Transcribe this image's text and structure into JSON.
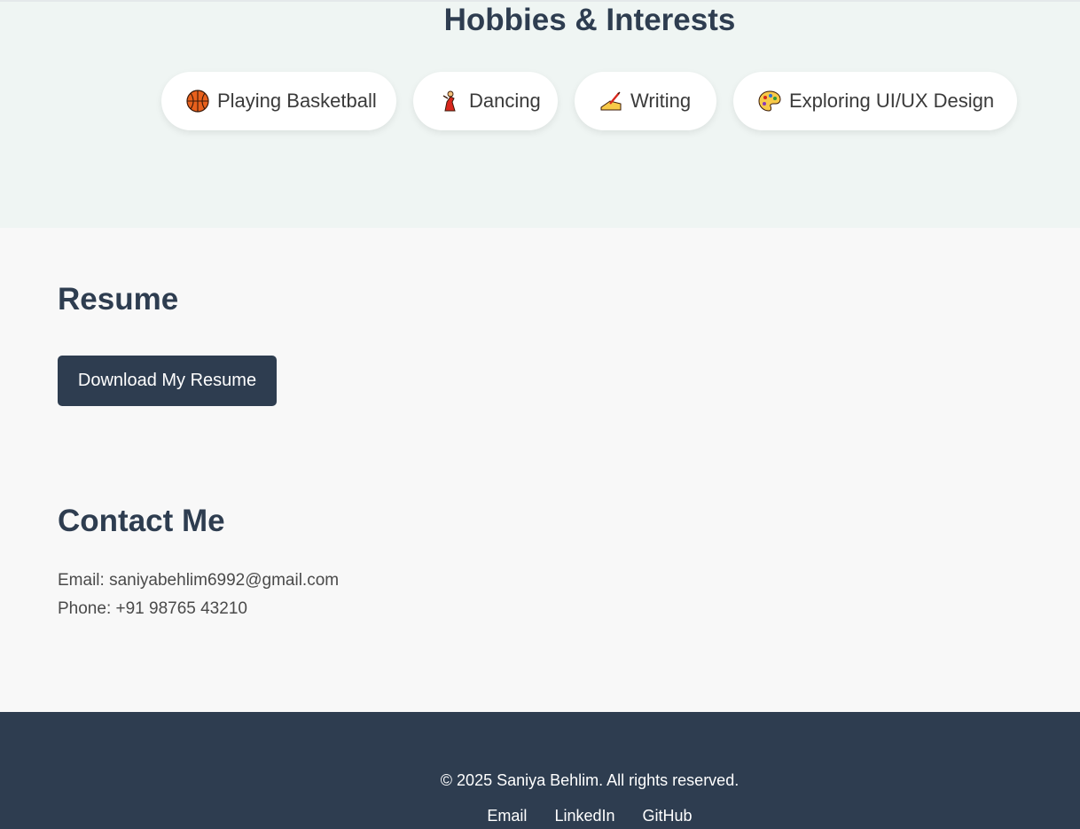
{
  "hobbies": {
    "title": "Hobbies & Interests",
    "items": [
      {
        "label": "Playing Basketball",
        "icon": "basketball-icon"
      },
      {
        "label": "Dancing",
        "icon": "dancer-icon"
      },
      {
        "label": "Writing",
        "icon": "writing-hand-icon"
      },
      {
        "label": "Exploring UI/UX Design",
        "icon": "palette-icon"
      }
    ]
  },
  "resume": {
    "title": "Resume",
    "button_label": "Download My Resume"
  },
  "contact": {
    "title": "Contact Me",
    "email_line": "Email: saniyabehlim6992@gmail.com",
    "phone_line": "Phone: +91 98765 43210"
  },
  "footer": {
    "copyright": "© 2025 Saniya Behlim. All rights reserved.",
    "links": [
      "Email",
      "LinkedIn",
      "GitHub"
    ]
  },
  "colors": {
    "primary": "#2e3d50",
    "hobbies_bg": "#eff5f3",
    "page_bg": "#f8f8f8"
  }
}
